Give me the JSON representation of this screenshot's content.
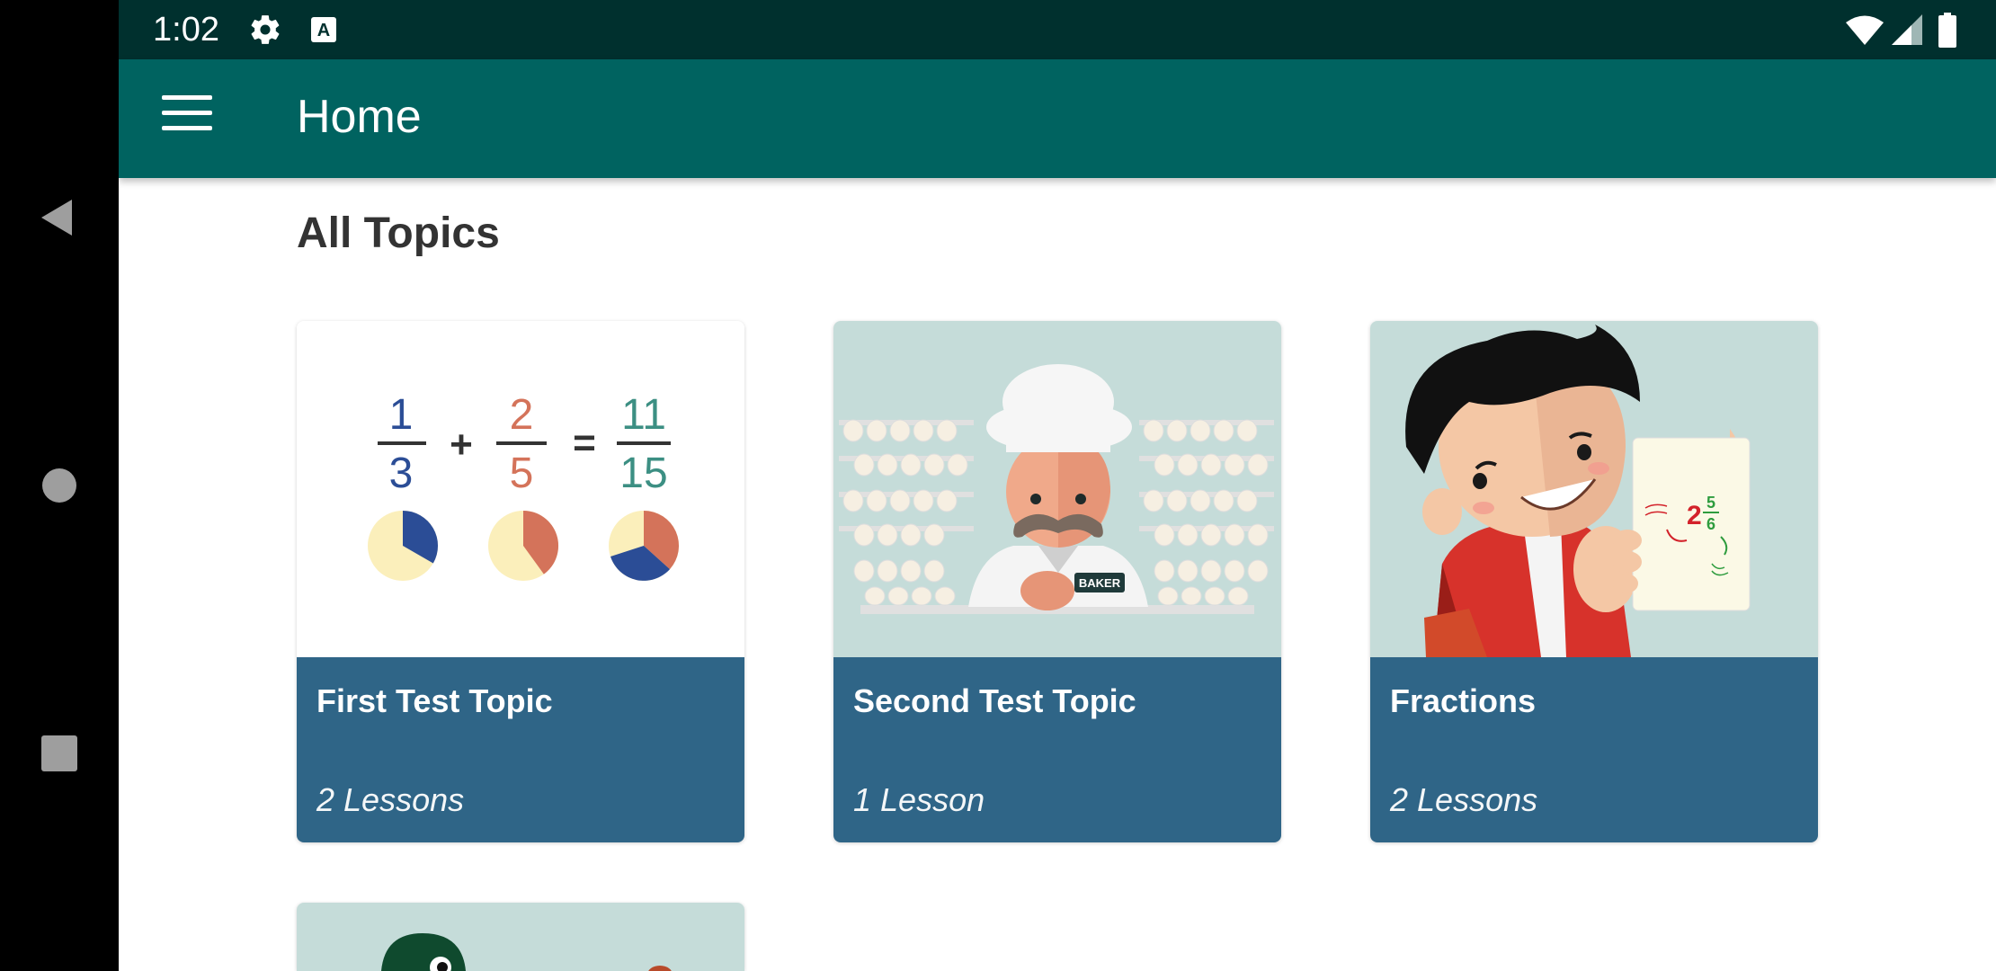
{
  "status_bar": {
    "time": "1:02",
    "icons": [
      "settings-icon",
      "text-a-icon",
      "wifi-icon",
      "signal-icon",
      "battery-icon"
    ]
  },
  "app_bar": {
    "title": "Home"
  },
  "main": {
    "section_title": "All Topics",
    "topics": [
      {
        "title": "First Test Topic",
        "lessons": "2 Lessons",
        "thumbnail": {
          "fractions": [
            {
              "num": "1",
              "den": "3",
              "color": "#2b4d96"
            },
            {
              "num": "2",
              "den": "5",
              "color": "#d4735a"
            },
            {
              "num": "11",
              "den": "15",
              "color": "#3c8f83"
            }
          ],
          "plus": "+",
          "equals": "="
        }
      },
      {
        "title": "Second Test Topic",
        "lessons": "1 Lesson",
        "thumbnail": {
          "badge": "BAKER"
        }
      },
      {
        "title": "Fractions",
        "lessons": "2 Lessons",
        "thumbnail": {
          "whole": "2",
          "num": "5",
          "den": "6"
        }
      }
    ]
  },
  "colors": {
    "status_bar": "#00302e",
    "app_bar": "#006360",
    "card_footer": "#2f6587",
    "thumbnail_bg": "#c5dcd9"
  }
}
